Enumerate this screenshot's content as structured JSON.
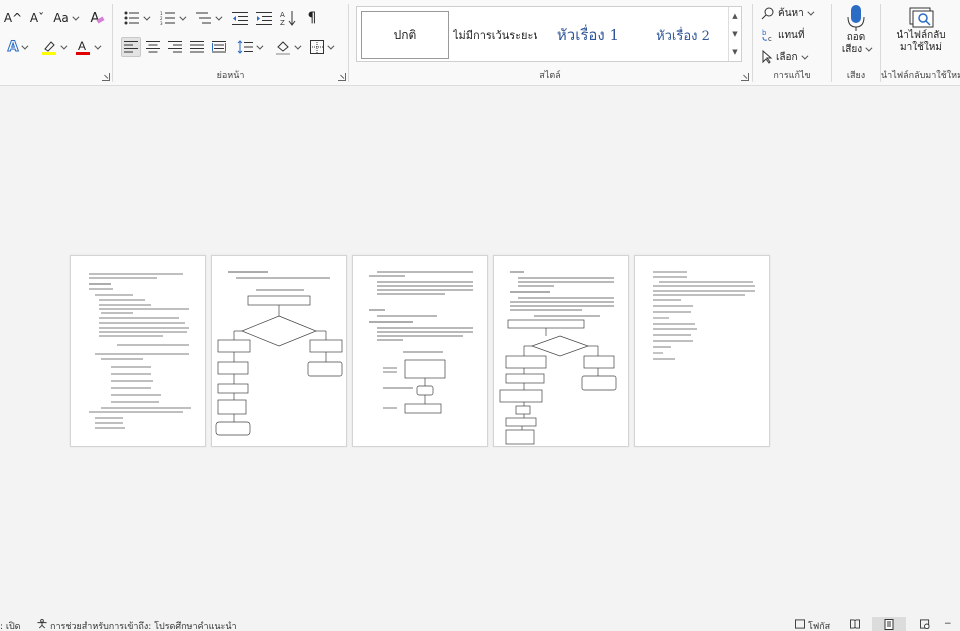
{
  "ribbon": {
    "font_group": {
      "grow_font": "A^",
      "shrink_font": "Aˇ",
      "change_case": "Aa",
      "clear_format": "A",
      "text_effects": "A",
      "highlight_color": "#ffff00",
      "font_color": "#e00000"
    },
    "paragraph_group": {
      "label": "ย่อหน้า",
      "pilcrow": "¶"
    },
    "styles_group": {
      "label": "สไตล์",
      "items": [
        "ปกติ",
        "ไม่มีการเว้นระยะห่",
        "หัวเรื่อง 1",
        "หัวเรื่อง 2"
      ],
      "heading_color": "#2f5597"
    },
    "editing_group": {
      "label": "การแก้ไข",
      "find": "ค้นหา",
      "replace": "แทนที่",
      "select": "เลือก"
    },
    "voice_group": {
      "label": "เสียง",
      "dictate_line1": "ถอด",
      "dictate_line2": "เสียง"
    },
    "reuse_group": {
      "label": "นำไฟล์กลับมาใช้ใหม่",
      "button_line1": "นำไฟล์กลับ",
      "button_line2": "มาใช้ใหม่"
    }
  },
  "document": {
    "page_count": 5,
    "pages": [
      {
        "id": 1,
        "content": "text"
      },
      {
        "id": 2,
        "content": "flowchart"
      },
      {
        "id": 3,
        "content": "text-and-flowchart"
      },
      {
        "id": 4,
        "content": "flowchart"
      },
      {
        "id": 5,
        "content": "text"
      }
    ]
  },
  "statusbar": {
    "left_fragment": ": เปิด",
    "accessibility": "การช่วยสำหรับการเข้าถึง: โปรดศึกษาคำแนะนำ",
    "focus": "โฟกัส",
    "zoom_minus": "−"
  }
}
